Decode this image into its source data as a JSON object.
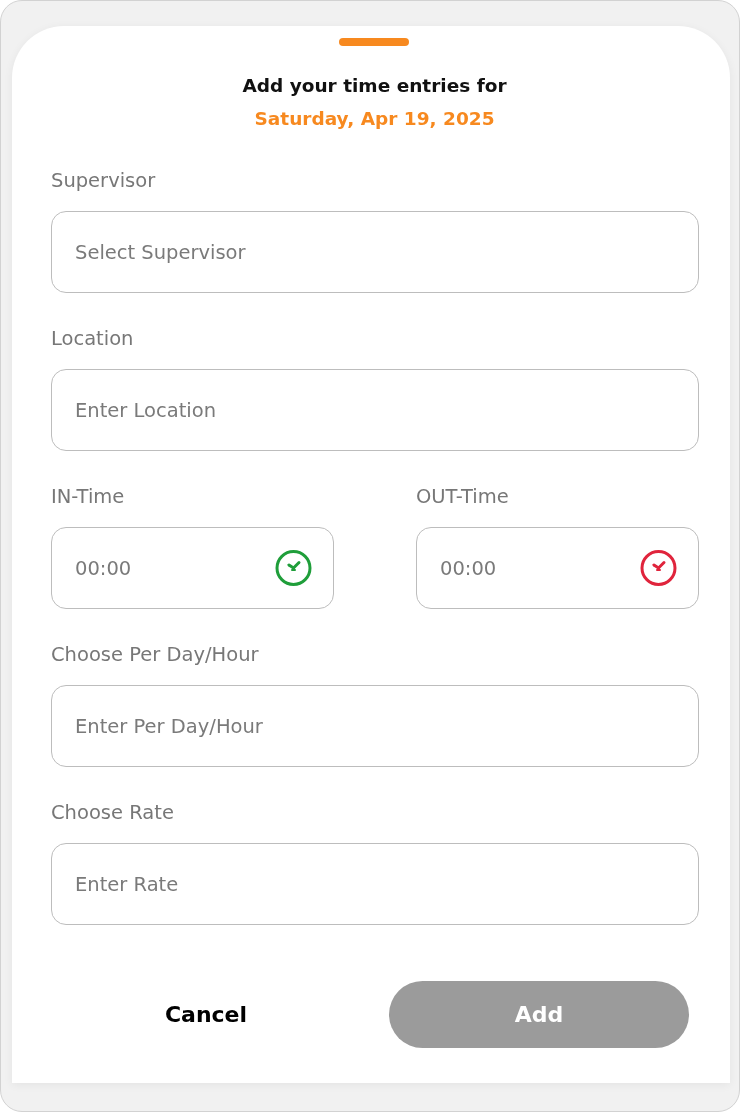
{
  "header": {
    "title": "Add your time entries for",
    "date": "Saturday, Apr 19, 2025"
  },
  "fields": [
    {
      "kind": "text",
      "label": "Supervisor",
      "placeholder": "Select Supervisor"
    },
    {
      "kind": "text",
      "label": "Location",
      "placeholder": "Enter Location"
    },
    {
      "kind": "time",
      "label": "IN-Time",
      "placeholder": "00:00",
      "color": "#1f9e3a"
    },
    {
      "kind": "time",
      "label": "OUT-Time",
      "placeholder": "00:00",
      "color": "#e0243c"
    },
    {
      "kind": "text",
      "label": "Choose Per Day/Hour",
      "placeholder": "Enter Per Day/Hour"
    },
    {
      "kind": "text",
      "label": "Choose Rate",
      "placeholder": "Enter Rate"
    }
  ],
  "actions": [
    {
      "kind": "text",
      "label": "Cancel",
      "disabled": false
    },
    {
      "kind": "filled",
      "label": "Add",
      "disabled": true
    }
  ]
}
